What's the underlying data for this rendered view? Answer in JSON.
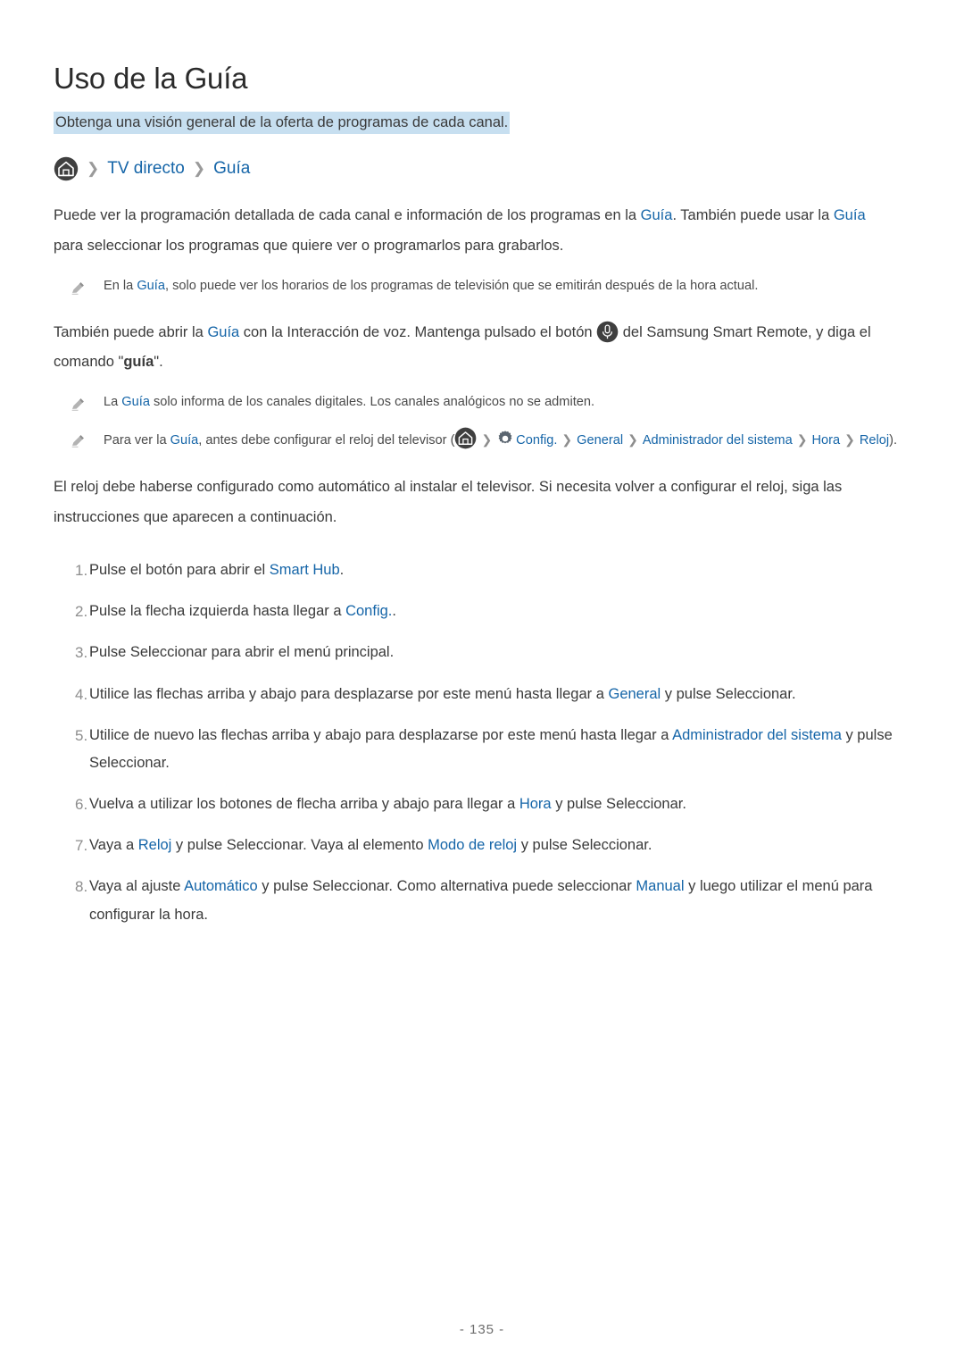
{
  "page": {
    "title": "Uso de la Guía",
    "subtitle": "Obtenga una visión general de la oferta de programas de cada canal.",
    "footer": "- 135 -"
  },
  "breadcrumb": {
    "home_icon": "home-icon",
    "sep": "❯",
    "item1": "TV directo",
    "item2": "Guía"
  },
  "paragraph1": {
    "t1": "Puede ver la programación detallada de cada canal e información de los programas en la ",
    "link1": "Guía",
    "t2": ". También puede usar la ",
    "link2": "Guía",
    "t3": " para seleccionar los programas que quiere ver o programarlos para grabarlos."
  },
  "note1": {
    "icon": "pencil-icon",
    "t1": "En la ",
    "link1": "Guía",
    "t2": ", solo puede ver los horarios de los programas de televisión que se emitirán después de la hora actual."
  },
  "paragraph2": {
    "t1": "También puede abrir la ",
    "link1": "Guía",
    "t2": " con la Interacción de voz. Mantenga pulsado el botón ",
    "icon": "microphone-icon",
    "t3": " del Samsung Smart Remote, y diga el comando \"",
    "bold1": "guía",
    "t4": "\"."
  },
  "note2": {
    "icon": "pencil-icon",
    "t1": "La ",
    "link1": "Guía",
    "t2": " solo informa de los canales digitales. Los canales analógicos no se admiten."
  },
  "note3": {
    "icon": "pencil-icon",
    "t1": "Para ver la ",
    "link1": "Guía",
    "t2": ", antes debe configurar el reloj del televisor (",
    "home_icon": "home-icon",
    "sep": "❯",
    "gear_icon": "gear-icon",
    "link2": "Config.",
    "link3": "General",
    "link4": "Administrador del sistema",
    "link5": "Hora",
    "link6": "Reloj",
    "t3": ")."
  },
  "paragraph3": {
    "t1": "El reloj debe haberse configurado como automático al instalar el televisor. Si necesita volver a configurar el reloj, siga las instrucciones que aparecen a continuación."
  },
  "steps": [
    {
      "num": "1.",
      "parts": [
        {
          "type": "text",
          "v": "Pulse el botón para abrir el "
        },
        {
          "type": "link",
          "v": "Smart Hub"
        },
        {
          "type": "text",
          "v": "."
        }
      ]
    },
    {
      "num": "2.",
      "parts": [
        {
          "type": "text",
          "v": "Pulse la flecha izquierda hasta llegar a "
        },
        {
          "type": "link",
          "v": "Config."
        },
        {
          "type": "text",
          "v": "."
        }
      ]
    },
    {
      "num": "3.",
      "parts": [
        {
          "type": "text",
          "v": "Pulse Seleccionar para abrir el menú principal."
        }
      ]
    },
    {
      "num": "4.",
      "parts": [
        {
          "type": "text",
          "v": "Utilice las flechas arriba y abajo para desplazarse por este menú hasta llegar a "
        },
        {
          "type": "link",
          "v": "General"
        },
        {
          "type": "text",
          "v": " y pulse Seleccionar."
        }
      ]
    },
    {
      "num": "5.",
      "parts": [
        {
          "type": "text",
          "v": "Utilice de nuevo las flechas arriba y abajo para desplazarse por este menú hasta llegar a "
        },
        {
          "type": "link",
          "v": "Administrador del sistema"
        },
        {
          "type": "text",
          "v": " y pulse Seleccionar."
        }
      ]
    },
    {
      "num": "6.",
      "parts": [
        {
          "type": "text",
          "v": "Vuelva a utilizar los botones de flecha arriba y abajo para llegar a "
        },
        {
          "type": "link",
          "v": "Hora"
        },
        {
          "type": "text",
          "v": " y pulse Seleccionar."
        }
      ]
    },
    {
      "num": "7.",
      "parts": [
        {
          "type": "text",
          "v": "Vaya a "
        },
        {
          "type": "link",
          "v": "Reloj"
        },
        {
          "type": "text",
          "v": " y pulse Seleccionar. Vaya al elemento "
        },
        {
          "type": "link",
          "v": "Modo de reloj"
        },
        {
          "type": "text",
          "v": " y pulse Seleccionar."
        }
      ]
    },
    {
      "num": "8.",
      "parts": [
        {
          "type": "text",
          "v": "Vaya al ajuste "
        },
        {
          "type": "link",
          "v": "Automático"
        },
        {
          "type": "text",
          "v": " y pulse Seleccionar. Como alternativa puede seleccionar "
        },
        {
          "type": "link",
          "v": "Manual"
        },
        {
          "type": "text",
          "v": " y luego utilizar el menú para configurar la hora."
        }
      ]
    }
  ],
  "colors": {
    "link": "#1565a8",
    "highlight": "#c7dff0",
    "text": "#3a3a3a",
    "muted": "#8d8d8d"
  }
}
